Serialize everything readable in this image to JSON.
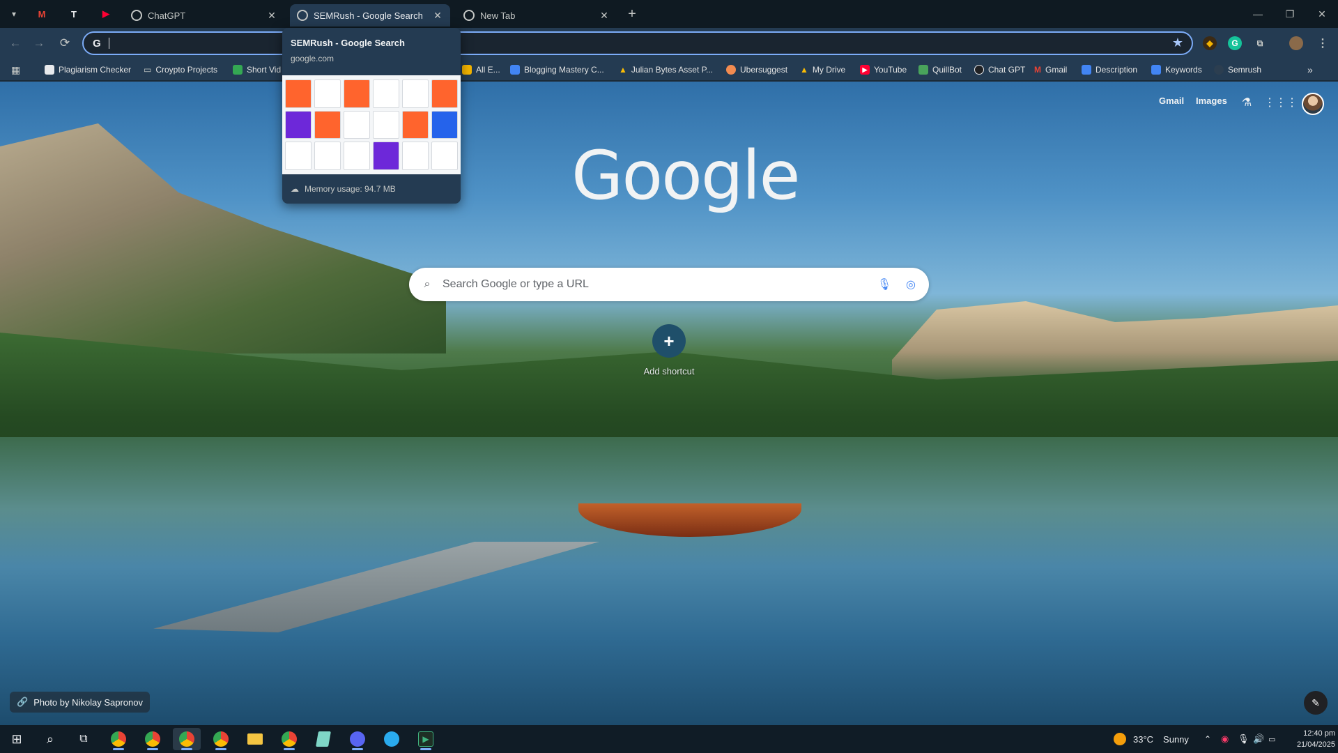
{
  "tabs": {
    "pinned": [
      {
        "name": "gmail",
        "label": "M",
        "color": "#ea4335"
      },
      {
        "name": "tweaker",
        "label": "T",
        "color": "#e8eaed"
      },
      {
        "name": "youtube",
        "label": "▶",
        "color": "#ff0033"
      }
    ],
    "items": [
      {
        "title": "ChatGPT",
        "active": false
      },
      {
        "title": "SEMRush - Google Search",
        "active": true
      },
      {
        "title": "New Tab",
        "active": false
      }
    ],
    "close_glyph": "✕",
    "new_tab_glyph": "+"
  },
  "window_controls": {
    "minimize": "—",
    "restore": "❐",
    "close": "✕"
  },
  "toolbar": {
    "back": "←",
    "forward": "→",
    "reload": "⟳",
    "omnibox_value": "",
    "omnibox_badge": "G",
    "bookmark_star": "★"
  },
  "bookmarks": [
    {
      "label": "Plagiarism Checker",
      "icon": "page-icon",
      "color": "#e8eaed"
    },
    {
      "label": "Croypto Projects",
      "icon": "folder-icon",
      "color": "#c4c7c5"
    },
    {
      "label": "Short Vid",
      "icon": "shortcut-icon",
      "color": "#34a853"
    },
    {
      "label": "All E...",
      "icon": "page-icon",
      "color": "#f4b400"
    },
    {
      "label": "Blogging Mastery C...",
      "icon": "docs-icon",
      "color": "#4285f4"
    },
    {
      "label": "Julian Bytes Asset P...",
      "icon": "drive-icon",
      "color": "#fbbc04"
    },
    {
      "label": "Ubersuggest",
      "icon": "ubersuggest-icon",
      "color": "#f28b50"
    },
    {
      "label": "My Drive",
      "icon": "drive-icon",
      "color": "#fbbc04"
    },
    {
      "label": "YouTube",
      "icon": "youtube-icon",
      "color": "#ff0033"
    },
    {
      "label": "QuillBot",
      "icon": "quillbot-icon",
      "color": "#49a35b"
    },
    {
      "label": "Chat GPT",
      "icon": "openai-icon",
      "color": "#e8eaed"
    },
    {
      "label": "Gmail",
      "icon": "gmail-icon",
      "color": "#ea4335"
    },
    {
      "label": "Description",
      "icon": "docs-icon",
      "color": "#4285f4"
    },
    {
      "label": "Keywords",
      "icon": "docs-icon",
      "color": "#4285f4"
    },
    {
      "label": "Semrush",
      "icon": "globe-icon",
      "color": "#e8eaed"
    }
  ],
  "bookmarks_more": "»",
  "ntp": {
    "logo": "Google",
    "gmail_link": "Gmail",
    "images_link": "Images",
    "search_placeholder": "Search Google or type a URL",
    "add_shortcut_label": "Add shortcut",
    "photo_credit": "Photo by Nikolay Sapronov"
  },
  "hover_card": {
    "title": "SEMRush - Google Search",
    "domain": "google.com",
    "memory": "Memory usage: 94.7 MB"
  },
  "taskbar": {
    "weather_temp": "33°C",
    "weather_desc": "Sunny",
    "time": "12:40 pm",
    "date": "21/04/2025"
  }
}
